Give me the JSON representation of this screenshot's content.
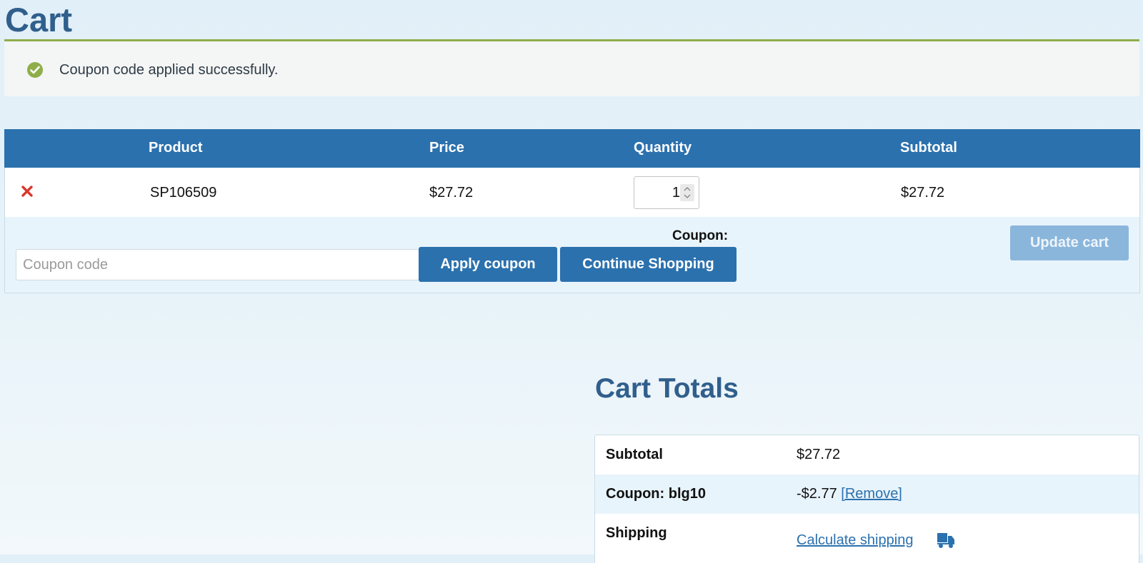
{
  "page": {
    "title": "Cart"
  },
  "notice": {
    "message": "Coupon code applied successfully.",
    "color": "#8fae49"
  },
  "cart_table": {
    "headers": {
      "product": "Product",
      "price": "Price",
      "quantity": "Quantity",
      "subtotal": "Subtotal"
    },
    "rows": [
      {
        "product": "SP106509",
        "price": "$27.72",
        "quantity": "1",
        "subtotal": "$27.72"
      }
    ],
    "remove_icon": "close-x-icon"
  },
  "coupon": {
    "label": "Coupon:",
    "placeholder": "Coupon code",
    "apply_label": "Apply coupon",
    "continue_label": "Continue Shopping",
    "update_label": "Update cart"
  },
  "totals": {
    "title": "Cart Totals",
    "subtotal_label": "Subtotal",
    "subtotal_value": "$27.72",
    "coupon_label": "Coupon: blg10",
    "coupon_value": "-$2.77",
    "coupon_remove": "[Remove]",
    "shipping_label": "Shipping",
    "shipping_link": "Calculate shipping",
    "shipping_icon": "delivery-truck-icon"
  },
  "colors": {
    "primary": "#2b71ae",
    "heading": "#305f8c",
    "disabled_button": "#8bb6dc",
    "remove": "#d9372c"
  }
}
